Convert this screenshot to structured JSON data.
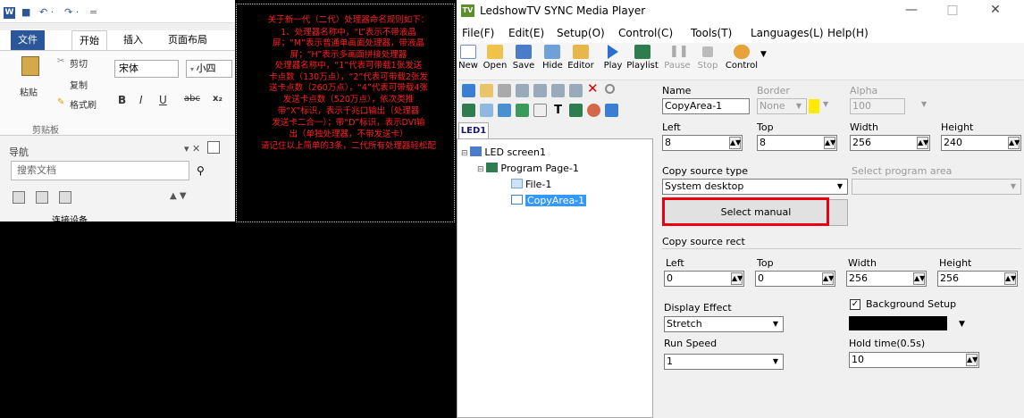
{
  "word": {
    "quick_access": [
      "↶ ·",
      "↷ ·",
      "="
    ],
    "tabs": [
      "文件",
      "开始",
      "插入",
      "页面布局"
    ],
    "clipboard": {
      "paste": "粘贴",
      "cut": "剪切",
      "copy": "复制",
      "format_painter": "格式刷",
      "group": "剪贴板"
    },
    "font_name": "宋体",
    "font_size": "小四",
    "nav": {
      "title": "导航",
      "search_placeholder": "搜索文档",
      "last_item": "连接设备"
    }
  },
  "red_text": [
    "关于新一代（二代）处理器命名规则如下：",
    "1、处理器名称中，“L”表示不带液晶",
    "屏；“M”表示普通单画面处理器，带液晶",
    "屏；“H”表示多画面拼接处理器",
    "处理器名称中，“1”代表可带载1张发送",
    "卡点数（130万点），“2”代表可带载2张发",
    "送卡点数（260万点），“4”代表可带载4张",
    "发送卡点数（520万点），依次类推",
    "带“X”标识，表示千兆口输出（处理器",
    "发送卡二合一）；带“D”标识，表示DVI输",
    "出（单独处理器，不带发送卡）",
    "请记住以上简单的3条，二代所有处理器轻松配"
  ],
  "app": {
    "title": "LedshowTV SYNC Media Player",
    "menu": [
      "File(F)",
      "Edit(E)",
      "Setup(O)",
      "Control(C)",
      "Tools(T)",
      "Languages(L)",
      "Help(H)"
    ],
    "toolbar": [
      "New",
      "Open",
      "Save",
      "Hide",
      "Editor",
      "Play",
      "Playlist",
      "Pause",
      "Stop",
      "Control"
    ],
    "led_tab": "LED1",
    "tree": {
      "screen": "LED screen1",
      "page": "Program Page-1",
      "file": "File-1",
      "copyarea": "CopyArea-1"
    }
  },
  "props": {
    "name_label": "Name",
    "name_value": "CopyArea-1",
    "border_label": "Border",
    "border_value": "None",
    "alpha_label": "Alpha",
    "alpha_value": "100",
    "left_label": "Left",
    "left_value": "8",
    "top_label": "Top",
    "top_value": "8",
    "width_label": "Width",
    "width_value": "256",
    "height_label": "Height",
    "height_value": "240",
    "copy_source_type_label": "Copy source type",
    "copy_source_type_value": "System desktop",
    "program_area_label": "Select program area",
    "select_manual": "Select manual",
    "copy_rect_label": "Copy source rect",
    "rect_left_label": "Left",
    "rect_left_value": "0",
    "rect_top_label": "Top",
    "rect_top_value": "0",
    "rect_width_label": "Width",
    "rect_width_value": "256",
    "rect_height_label": "Height",
    "rect_height_value": "256",
    "display_effect_label": "Display Effect",
    "display_effect_value": "Stretch",
    "background_setup_label": "Background Setup",
    "run_speed_label": "Run Speed",
    "run_speed_value": "1",
    "hold_time_label": "Hold time(0.5s)",
    "hold_time_value": "10"
  },
  "colors": {
    "highlight": "#e60012",
    "selection": "#3399ff",
    "warning_text": "#ff2020",
    "word_blue": "#2b579a"
  }
}
